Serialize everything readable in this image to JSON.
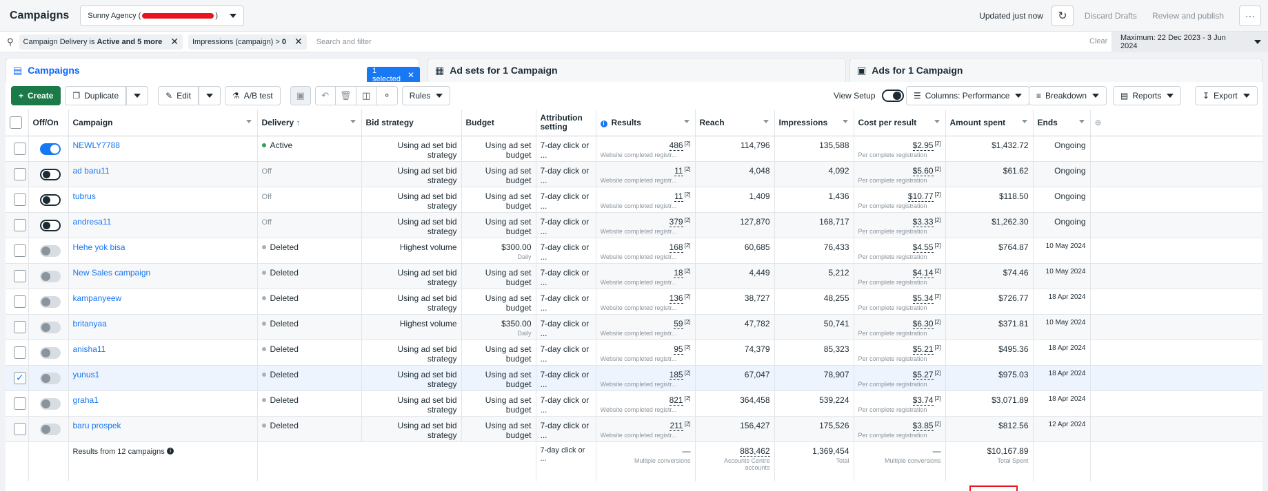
{
  "header": {
    "title": "Campaigns",
    "account_prefix": "Sunny Agency (",
    "account_suffix": ")",
    "updated": "Updated just now",
    "discard": "Discard Drafts",
    "review": "Review and publish",
    "more": "···"
  },
  "filters": {
    "chip1_text": "Campaign Delivery is",
    "chip1_bold": "Active and 5 more",
    "chip2_text": "Impressions (campaign) >",
    "chip2_bold": "0",
    "placeholder": "Search and filter",
    "clear": "Clear",
    "date_range": "Maximum: 22 Dec 2023 - 3 Jun 2024"
  },
  "tabs": {
    "campaigns": "Campaigns",
    "selected": "1 selected",
    "adsets": "Ad sets for 1 Campaign",
    "ads": "Ads for 1 Campaign"
  },
  "toolbar": {
    "create": "Create",
    "duplicate": "Duplicate",
    "edit": "Edit",
    "ab_test": "A/B test",
    "rules": "Rules",
    "view_setup": "View Setup",
    "columns": "Columns: Performance",
    "breakdown": "Breakdown",
    "reports": "Reports",
    "export": "Export"
  },
  "columns": {
    "offon": "Off/On",
    "campaign": "Campaign",
    "delivery": "Delivery",
    "bid": "Bid strategy",
    "budget": "Budget",
    "attribution": "Attribution setting",
    "results": "Results",
    "reach": "Reach",
    "impressions": "Impressions",
    "cpr": "Cost per result",
    "spent": "Amount spent",
    "ends": "Ends"
  },
  "rows": [
    {
      "name": "NEWLY7788",
      "toggle": "on",
      "delivery": "Active",
      "dstate": "active",
      "bid": "Using ad set bid strategy",
      "budget": "Using ad set budget",
      "budget_sub": "",
      "attr": "7-day click or ...",
      "results": "486",
      "results_sub": "Website completed registr...",
      "reach": "114,796",
      "impr": "135,588",
      "cpr": "$2.95",
      "cpr_sub": "Per complete registration",
      "spent": "$1,432.72",
      "ends": "Ongoing",
      "checked": false
    },
    {
      "name": "ad baru11",
      "toggle": "off",
      "delivery": "Off",
      "dstate": "off",
      "bid": "Using ad set bid strategy",
      "budget": "Using ad set budget",
      "budget_sub": "",
      "attr": "7-day click or ...",
      "results": "11",
      "results_sub": "Website completed registr...",
      "reach": "4,048",
      "impr": "4,092",
      "cpr": "$5.60",
      "cpr_sub": "Per complete registration",
      "spent": "$61.62",
      "ends": "Ongoing",
      "checked": false
    },
    {
      "name": "tubrus",
      "toggle": "off",
      "delivery": "Off",
      "dstate": "off",
      "bid": "Using ad set bid strategy",
      "budget": "Using ad set budget",
      "budget_sub": "",
      "attr": "7-day click or ...",
      "results": "11",
      "results_sub": "Website completed registr...",
      "reach": "1,409",
      "impr": "1,436",
      "cpr": "$10.77",
      "cpr_sub": "Per complete registration",
      "spent": "$118.50",
      "ends": "Ongoing",
      "checked": false
    },
    {
      "name": "andresa11",
      "toggle": "off",
      "delivery": "Off",
      "dstate": "off",
      "bid": "Using ad set bid strategy",
      "budget": "Using ad set budget",
      "budget_sub": "",
      "attr": "7-day click or ...",
      "results": "379",
      "results_sub": "Website completed registr...",
      "reach": "127,870",
      "impr": "168,717",
      "cpr": "$3.33",
      "cpr_sub": "Per complete registration",
      "spent": "$1,262.30",
      "ends": "Ongoing",
      "checked": false
    },
    {
      "name": "Hehe yok bisa",
      "toggle": "del",
      "delivery": "Deleted",
      "dstate": "deleted",
      "bid": "Highest volume",
      "budget": "$300.00",
      "budget_sub": "Daily",
      "attr": "7-day click or ...",
      "results": "168",
      "results_sub": "Website completed registr...",
      "reach": "60,685",
      "impr": "76,433",
      "cpr": "$4.55",
      "cpr_sub": "Per complete registration",
      "spent": "$764.87",
      "ends": "10 May 2024",
      "checked": false
    },
    {
      "name": "New Sales campaign",
      "toggle": "del",
      "delivery": "Deleted",
      "dstate": "deleted",
      "bid": "Using ad set bid strategy",
      "budget": "Using ad set budget",
      "budget_sub": "",
      "attr": "7-day click or ...",
      "results": "18",
      "results_sub": "Website completed registr...",
      "reach": "4,449",
      "impr": "5,212",
      "cpr": "$4.14",
      "cpr_sub": "Per complete registration",
      "spent": "$74.46",
      "ends": "10 May 2024",
      "checked": false
    },
    {
      "name": "kampanyeew",
      "toggle": "del",
      "delivery": "Deleted",
      "dstate": "deleted",
      "bid": "Using ad set bid strategy",
      "budget": "Using ad set budget",
      "budget_sub": "",
      "attr": "7-day click or ...",
      "results": "136",
      "results_sub": "Website completed registr...",
      "reach": "38,727",
      "impr": "48,255",
      "cpr": "$5.34",
      "cpr_sub": "Per complete registration",
      "spent": "$726.77",
      "ends": "18 Apr 2024",
      "checked": false
    },
    {
      "name": "britanyaa",
      "toggle": "del",
      "delivery": "Deleted",
      "dstate": "deleted",
      "bid": "Highest volume",
      "budget": "$350.00",
      "budget_sub": "Daily",
      "attr": "7-day click or ...",
      "results": "59",
      "results_sub": "Website completed registr...",
      "reach": "47,782",
      "impr": "50,741",
      "cpr": "$6.30",
      "cpr_sub": "Per complete registration",
      "spent": "$371.81",
      "ends": "10 May 2024",
      "checked": false
    },
    {
      "name": "anisha11",
      "toggle": "del",
      "delivery": "Deleted",
      "dstate": "deleted",
      "bid": "Using ad set bid strategy",
      "budget": "Using ad set budget",
      "budget_sub": "",
      "attr": "7-day click or ...",
      "results": "95",
      "results_sub": "Website completed registr...",
      "reach": "74,379",
      "impr": "85,323",
      "cpr": "$5.21",
      "cpr_sub": "Per complete registration",
      "spent": "$495.36",
      "ends": "18 Apr 2024",
      "checked": false
    },
    {
      "name": "yunus1",
      "toggle": "del",
      "delivery": "Deleted",
      "dstate": "deleted",
      "bid": "Using ad set bid strategy",
      "budget": "Using ad set budget",
      "budget_sub": "",
      "attr": "7-day click or ...",
      "results": "185",
      "results_sub": "Website completed registr...",
      "reach": "67,047",
      "impr": "78,907",
      "cpr": "$5.27",
      "cpr_sub": "Per complete registration",
      "spent": "$975.03",
      "ends": "18 Apr 2024",
      "checked": true
    },
    {
      "name": "graha1",
      "toggle": "del",
      "delivery": "Deleted",
      "dstate": "deleted",
      "bid": "Using ad set bid strategy",
      "budget": "Using ad set budget",
      "budget_sub": "",
      "attr": "7-day click or ...",
      "results": "821",
      "results_sub": "Website completed registr...",
      "reach": "364,458",
      "impr": "539,224",
      "cpr": "$3.74",
      "cpr_sub": "Per complete registration",
      "spent": "$3,071.89",
      "ends": "18 Apr 2024",
      "checked": false
    },
    {
      "name": "baru prospek",
      "toggle": "del",
      "delivery": "Deleted",
      "dstate": "deleted",
      "bid": "Using ad set bid strategy",
      "budget": "Using ad set budget",
      "budget_sub": "",
      "attr": "7-day click or ...",
      "results": "211",
      "results_sub": "Website completed registr...",
      "reach": "156,427",
      "impr": "175,526",
      "cpr": "$3.85",
      "cpr_sub": "Per complete registration",
      "spent": "$812.56",
      "ends": "12 Apr 2024",
      "checked": false
    }
  ],
  "summary": {
    "label": "Results from 12 campaigns",
    "attr": "7-day click or ...",
    "results": "—",
    "results_sub": "Multiple conversions",
    "reach": "883,462",
    "reach_sub": "Accounts Centre accounts",
    "impr": "1,369,454",
    "impr_sub": "Total",
    "cpr": "—",
    "cpr_sub": "Multiple conversions",
    "spent": "$10,167.89",
    "spent_sub": "Total Spent"
  },
  "colors": {
    "accent": "#1877f2",
    "create_green": "#1c7a48",
    "highlight_red": "#e8141f"
  }
}
